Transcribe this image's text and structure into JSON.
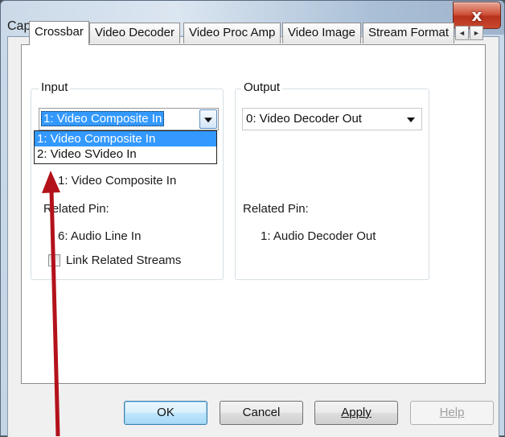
{
  "window": {
    "title": "Capture",
    "close_glyph": "x"
  },
  "tabs": [
    {
      "label": "Crossbar",
      "active": true
    },
    {
      "label": "Video Decoder",
      "active": false
    },
    {
      "label": "Video Proc Amp",
      "active": false
    },
    {
      "label": "Video Image",
      "active": false
    },
    {
      "label": "Stream Format",
      "active": false
    }
  ],
  "tab_scroll": {
    "left_glyph": "◄",
    "right_glyph": "►"
  },
  "input_group": {
    "label": "Input",
    "combo_value": "1: Video Composite In",
    "options": [
      "1: Video Composite In",
      "2: Video SVideo In"
    ],
    "current_label": "1: Video Composite In",
    "related_pin_label": "Related Pin:",
    "related_pin_value": "6: Audio Line In",
    "link_checkbox_label": "Link Related Streams"
  },
  "output_group": {
    "label": "Output",
    "combo_value": "0: Video Decoder Out",
    "related_pin_label": "Related Pin:",
    "related_pin_value": "1: Audio Decoder Out"
  },
  "buttons": {
    "ok": "OK",
    "cancel": "Cancel",
    "apply": "Apply",
    "help": "Help"
  },
  "colors": {
    "selection": "#3399ff",
    "annotation_arrow": "#b3121b"
  }
}
